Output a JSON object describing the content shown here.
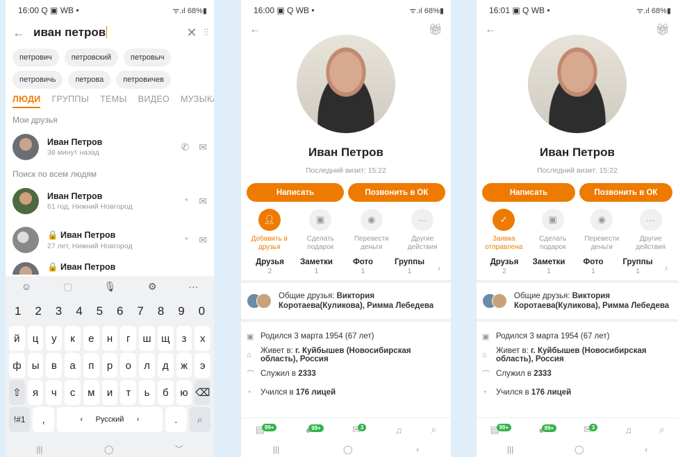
{
  "screens": [
    {
      "status": {
        "time": "16:00",
        "icons": "Q ▣ WB •",
        "right": "ᯤ.ıl 68%▮"
      },
      "search": {
        "query": "иван петров"
      },
      "suggestions": [
        "петрович",
        "петровский",
        "петровыч",
        "петровичь",
        "петрова",
        "петровичев"
      ],
      "tabs": [
        "ЛЮДИ",
        "ГРУППЫ",
        "ТЕМЫ",
        "ВИДЕО",
        "МУЗЫКА"
      ],
      "friends_header": "Мои друзья",
      "friend": {
        "name": "Иван Петров",
        "sub": "38 минут назад"
      },
      "all_header": "Поиск по всем людям",
      "results": [
        {
          "name": "Иван Петров",
          "sub": "61 год, Нижний Новгород"
        },
        {
          "name": "🔒 Иван Петров",
          "sub": "27 лет, Нижний Новгород"
        },
        {
          "name": "🔒 Иван Петров",
          "sub": ""
        }
      ],
      "keyboard": {
        "numbers": [
          "1",
          "2",
          "3",
          "4",
          "5",
          "6",
          "7",
          "8",
          "9",
          "0"
        ],
        "row1": [
          "й",
          "ц",
          "у",
          "к",
          "е",
          "н",
          "г",
          "ш",
          "щ",
          "з",
          "х"
        ],
        "row2": [
          "ф",
          "ы",
          "в",
          "а",
          "п",
          "р",
          "о",
          "л",
          "д",
          "ж",
          "э"
        ],
        "row3": [
          "я",
          "ч",
          "с",
          "м",
          "и",
          "т",
          "ь",
          "б",
          "ю"
        ],
        "sym": "!#1",
        "comma": ",",
        "space": "Русский",
        "dot": "."
      }
    },
    {
      "status": {
        "time": "16:00",
        "icons": "▣ Q WB •",
        "right": "ᯤ.ıl 68%▮"
      },
      "name": "Иван Петров",
      "last_visit": "Последний визит: 15:22",
      "write": "Написать",
      "call": "Позвонить в ОК",
      "actions": [
        {
          "label": "Добавить в друзья"
        },
        {
          "label": "Сделать подарок"
        },
        {
          "label": "Перевести деньги"
        },
        {
          "label": "Другие действия"
        }
      ],
      "counts": [
        {
          "label": "Друзья",
          "n": "2"
        },
        {
          "label": "Заметки",
          "n": "1"
        },
        {
          "label": "Фото",
          "n": "1"
        },
        {
          "label": "Группы",
          "n": "1"
        }
      ],
      "mutual_prefix": "Общие друзья:",
      "mutual_names": "Виктория Коротаева(Куликова), Римма Лебедева",
      "born": "Родился 3 марта 1954 (67 лет)",
      "lives_prefix": "Живет в:",
      "lives": "г. Куйбышев (Новосибирская область), Россия",
      "served_prefix": "Служил в",
      "served": "2333",
      "studied_prefix": "Учился в",
      "studied": "176 лицей",
      "badges": {
        "feed": "99+",
        "msgs": "99+",
        "mail": "3"
      }
    },
    {
      "status": {
        "time": "16:01",
        "icons": "▣ Q WB •",
        "right": "ᯤ.ıl 68%▮"
      },
      "name": "Иван Петров",
      "last_visit": "Последний визит: 15:22",
      "write": "Написать",
      "call": "Позвонить в ОК",
      "actions": [
        {
          "label": "Заявка отправлена"
        },
        {
          "label": "Сделать подарок"
        },
        {
          "label": "Перевести деньги"
        },
        {
          "label": "Другие действия"
        }
      ],
      "counts": [
        {
          "label": "Друзья",
          "n": "2"
        },
        {
          "label": "Заметки",
          "n": "1"
        },
        {
          "label": "Фото",
          "n": "1"
        },
        {
          "label": "Группы",
          "n": "1"
        }
      ],
      "mutual_prefix": "Общие друзья:",
      "mutual_names": "Виктория Коротаева(Куликова), Римма Лебедева",
      "born": "Родился 3 марта 1954 (67 лет)",
      "lives_prefix": "Живет в:",
      "lives": "г. Куйбышев (Новосибирская область), Россия",
      "served_prefix": "Служил в",
      "served": "2333",
      "studied_prefix": "Учился в",
      "studied": "176 лицей",
      "badges": {
        "feed": "99+",
        "msgs": "99+",
        "mail": "3"
      }
    }
  ]
}
